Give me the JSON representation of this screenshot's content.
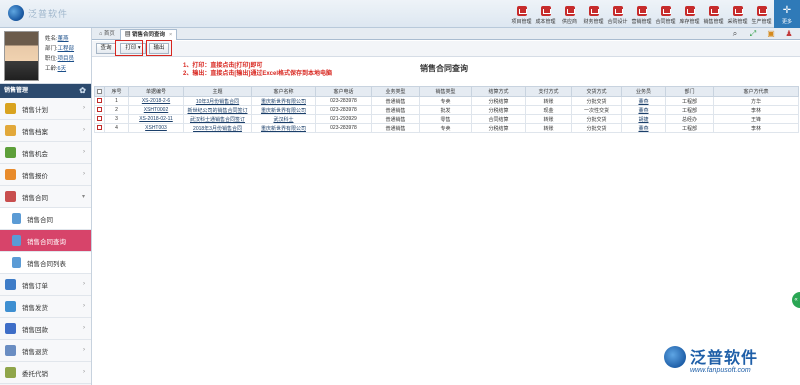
{
  "app": {
    "logo_text": "泛普软件"
  },
  "topnav": {
    "items": [
      "项目管理",
      "成本管理",
      "供应商",
      "财务管理",
      "合同设计",
      "营销管理",
      "合同管理",
      "库存管理",
      "销售管理",
      "采购管理",
      "生产管理"
    ],
    "more": "更多"
  },
  "user": {
    "name_label": "姓名:",
    "name": "董燕",
    "dept_label": "部门:",
    "dept": "工程部",
    "role_label": "职位:",
    "role": "项目员",
    "work_label": "工龄:",
    "work": "6天"
  },
  "sidebar": {
    "module": "销售管理",
    "items": [
      {
        "label": "销售计划",
        "color": "#d9a31f"
      },
      {
        "label": "销售档案",
        "color": "#e2a83a"
      },
      {
        "label": "销售机会",
        "color": "#5d9f3a"
      },
      {
        "label": "销售报价",
        "color": "#e88b2b"
      },
      {
        "label": "销售合同",
        "color": "#c84e4e"
      },
      {
        "label": "销售合同",
        "sub": true
      },
      {
        "label": "销售合同查询",
        "sub": true,
        "active": true
      },
      {
        "label": "销售合同列表",
        "sub": true
      },
      {
        "label": "销售订单",
        "color": "#3e7cc7"
      },
      {
        "label": "销售发货",
        "color": "#3e8fd1"
      },
      {
        "label": "销售回款",
        "color": "#3e6ec7"
      },
      {
        "label": "销售退货",
        "color": "#6a8dc2"
      },
      {
        "label": "委托代销",
        "color": "#8fa54a"
      }
    ]
  },
  "tabs": {
    "home": "首页",
    "active": "销售合同查询"
  },
  "toolbar": {
    "query": "查询",
    "print": "打印",
    "export": "输出"
  },
  "annotation": {
    "line1": "1、打印：直接点击[打印]即可",
    "line2": "2、输出：直接点击[输出]通过Excel格式保存到本地电脑"
  },
  "page_title": "销售合同查询",
  "table": {
    "columns": [
      "序号",
      "单据编号",
      "主题",
      "客户名称",
      "客户电话",
      "业务类型",
      "销售类型",
      "结算方式",
      "支付方式",
      "交货方式",
      "业务员",
      "部门",
      "客户方代表"
    ],
    "rows": [
      [
        "1",
        "XS-2018-2-6",
        "10年3月份销售合同",
        "重庆新世界有限公司",
        "023-283978",
        "普通销售",
        "专卖",
        "分税结算",
        "转账",
        "分批交货",
        "董燕",
        "工程部",
        "方华"
      ],
      [
        "2",
        "XSHT0002",
        "新世纪公司的销售合同签订",
        "重庆新世界有限公司",
        "023-283978",
        "普通销售",
        "批发",
        "分税结算",
        "现金",
        "一次性交货",
        "董燕",
        "工程部",
        "李林"
      ],
      [
        "3",
        "XS-2018-02-11",
        "武汉科士通销售合同签订",
        "武汉科士",
        "021-293929",
        "普通销售",
        "零售",
        "合同结算",
        "转账",
        "分批交货",
        "胡捷",
        "总经办",
        "王锋"
      ],
      [
        "4",
        "XSHT003",
        "2018年3月份销售合同",
        "重庆新世界有限公司",
        "023-283978",
        "普通销售",
        "专卖",
        "分税结算",
        "转账",
        "分批交货",
        "董燕",
        "工程部",
        "李林"
      ]
    ]
  },
  "bottom_logo": {
    "text": "泛普软件",
    "url": "www.fanpusoft.com"
  },
  "side_handle": "«"
}
